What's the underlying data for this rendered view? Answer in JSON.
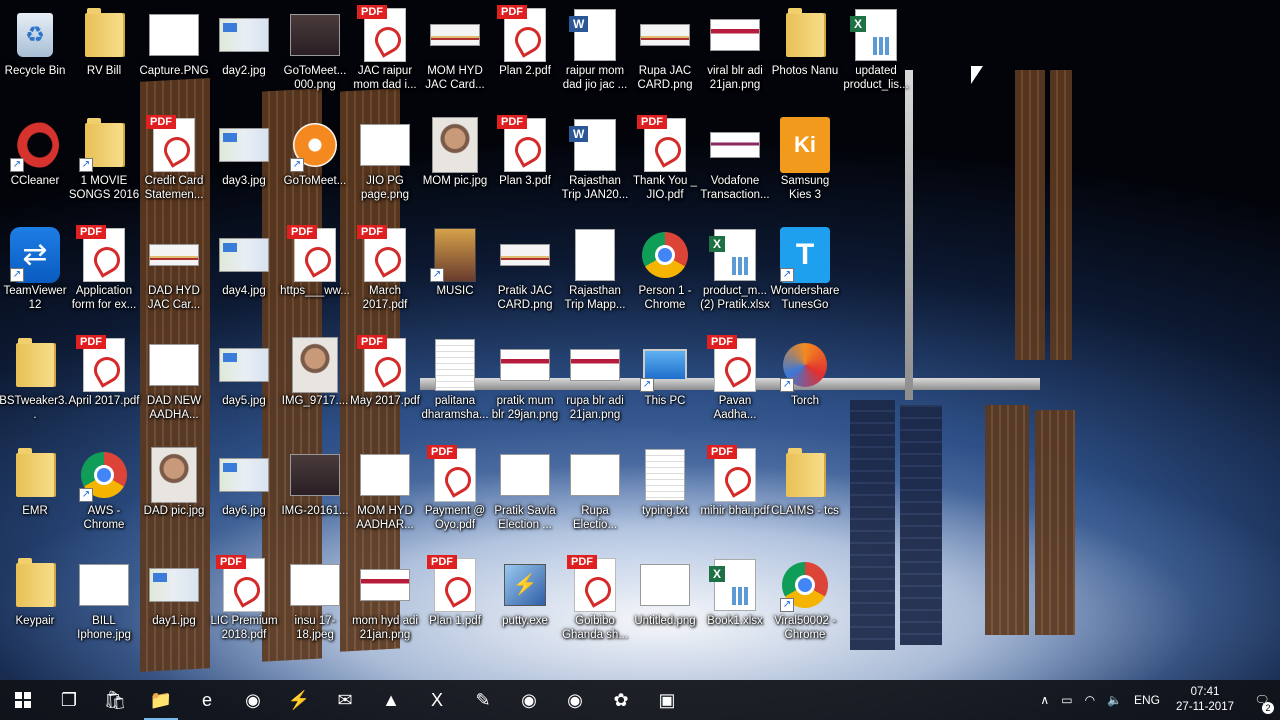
{
  "desktop": {
    "icons": [
      {
        "label": "Recycle Bin",
        "type": "recycle",
        "shortcut": false
      },
      {
        "label": "RV Bill",
        "type": "folder",
        "shortcut": false
      },
      {
        "label": "Capture.PNG",
        "type": "doc",
        "shortcut": false
      },
      {
        "label": "day2.jpg",
        "type": "map",
        "shortcut": false
      },
      {
        "label": "GoToMeet... 000.png",
        "type": "dark",
        "shortcut": false
      },
      {
        "label": "JAC raipur mom dad i...",
        "type": "pdf",
        "shortcut": false
      },
      {
        "label": "MOM HYD JAC Card...",
        "type": "card",
        "shortcut": false
      },
      {
        "label": "Plan 2.pdf",
        "type": "pdf",
        "shortcut": false
      },
      {
        "label": "raipur mom dad jio jac ...",
        "type": "word",
        "shortcut": false
      },
      {
        "label": "Rupa JAC CARD.png",
        "type": "card",
        "shortcut": false
      },
      {
        "label": "viral blr adi 21jan.png",
        "type": "web",
        "shortcut": false
      },
      {
        "label": "Photos Nanu",
        "type": "folder",
        "shortcut": false
      },
      {
        "label": "updated product_lis...",
        "type": "excel",
        "shortcut": false
      },
      {
        "label": "CCleaner",
        "type": "ccleaner",
        "shortcut": true
      },
      {
        "label": "1 MOVIE SONGS 2016",
        "type": "folder",
        "shortcut": true
      },
      {
        "label": "Credit Card Statemen...",
        "type": "pdf",
        "shortcut": false
      },
      {
        "label": "day3.jpg",
        "type": "map",
        "shortcut": false
      },
      {
        "label": "GoToMeet...",
        "type": "gotomeet",
        "shortcut": true
      },
      {
        "label": "JIO PG page.png",
        "type": "doc",
        "shortcut": false
      },
      {
        "label": "MOM pic.jpg",
        "type": "photo",
        "shortcut": false
      },
      {
        "label": "Plan 3.pdf",
        "type": "pdf",
        "shortcut": false
      },
      {
        "label": "Rajasthan Trip JAN20...",
        "type": "word",
        "shortcut": false
      },
      {
        "label": "Thank You _ JIO.pdf",
        "type": "pdf",
        "shortcut": false
      },
      {
        "label": "Vodafone Transaction...",
        "type": "pink",
        "shortcut": false
      },
      {
        "label": "Samsung Kies 3",
        "type": "kies",
        "shortcut": false
      },
      {
        "label": "TeamViewer 12",
        "type": "teamviewer",
        "shortcut": true
      },
      {
        "label": "Application form for ex...",
        "type": "pdf",
        "shortcut": false
      },
      {
        "label": "DAD HYD JAC Car...",
        "type": "card",
        "shortcut": false
      },
      {
        "label": "day4.jpg",
        "type": "map",
        "shortcut": false
      },
      {
        "label": "https___ww...",
        "type": "pdf",
        "shortcut": false
      },
      {
        "label": "March 2017.pdf",
        "type": "pdf",
        "shortcut": false
      },
      {
        "label": "MUSIC",
        "type": "music",
        "shortcut": true
      },
      {
        "label": "Pratik JAC CARD.png",
        "type": "card",
        "shortcut": false
      },
      {
        "label": "Rajasthan Trip Mapp...",
        "type": "gen",
        "shortcut": false
      },
      {
        "label": "Person 1 - Chrome",
        "type": "chrome",
        "shortcut": false
      },
      {
        "label": "product_m... (2) Pratik.xlsx",
        "type": "excel",
        "shortcut": false
      },
      {
        "label": "Wondershare TunesGo",
        "type": "wondershare",
        "shortcut": true
      },
      {
        "label": "BSTweaker3...",
        "type": "folder",
        "shortcut": false
      },
      {
        "label": "April 2017.pdf",
        "type": "pdf",
        "shortcut": false
      },
      {
        "label": "DAD NEW AADHA...",
        "type": "doc",
        "shortcut": false
      },
      {
        "label": "day5.jpg",
        "type": "map",
        "shortcut": false
      },
      {
        "label": "IMG_9717....",
        "type": "photo",
        "shortcut": false
      },
      {
        "label": "May 2017.pdf",
        "type": "pdf",
        "shortcut": false
      },
      {
        "label": "palitana dharamsha...",
        "type": "txt",
        "shortcut": false
      },
      {
        "label": "pratik mum blr 29jan.png",
        "type": "web",
        "shortcut": false
      },
      {
        "label": "rupa blr adi 21jan.png",
        "type": "web",
        "shortcut": false
      },
      {
        "label": "This PC",
        "type": "pc",
        "shortcut": true
      },
      {
        "label": "Pavan Aadha...",
        "type": "pdf",
        "shortcut": false
      },
      {
        "label": "Torch",
        "type": "torch",
        "shortcut": true
      },
      {
        "label": "EMR",
        "type": "folder",
        "shortcut": false
      },
      {
        "label": "AWS - Chrome",
        "type": "chrome",
        "shortcut": true
      },
      {
        "label": "DAD pic.jpg",
        "type": "photo",
        "shortcut": false
      },
      {
        "label": "day6.jpg",
        "type": "map",
        "shortcut": false
      },
      {
        "label": "IMG-20161...",
        "type": "dark",
        "shortcut": false
      },
      {
        "label": "MOM HYD AADHAR...",
        "type": "doc",
        "shortcut": false
      },
      {
        "label": "Payment @ Oyo.pdf",
        "type": "pdf",
        "shortcut": false
      },
      {
        "label": "Pratik Savla Election ...",
        "type": "doc",
        "shortcut": false
      },
      {
        "label": "Rupa Electio...",
        "type": "doc",
        "shortcut": false
      },
      {
        "label": "typing.txt",
        "type": "txt",
        "shortcut": false
      },
      {
        "label": "mihir bhai.pdf",
        "type": "pdf",
        "shortcut": false
      },
      {
        "label": "CLAIMS - tcs",
        "type": "folder",
        "shortcut": false
      },
      {
        "label": "Keypair",
        "type": "folder",
        "shortcut": false
      },
      {
        "label": "BILL Iphone.jpg",
        "type": "doc",
        "shortcut": false
      },
      {
        "label": "day1.jpg",
        "type": "map",
        "shortcut": false
      },
      {
        "label": "LIC Premium 2018.pdf",
        "type": "pdf",
        "shortcut": false
      },
      {
        "label": "insu 17-18.jpeg",
        "type": "doc",
        "shortcut": false
      },
      {
        "label": "mom hyd adi 21jan.png",
        "type": "web",
        "shortcut": false
      },
      {
        "label": "Plan 1.pdf",
        "type": "pdf",
        "shortcut": false
      },
      {
        "label": "putty.exe",
        "type": "putty",
        "shortcut": false
      },
      {
        "label": "Goibibo Ghanda sh...",
        "type": "pdf",
        "shortcut": false
      },
      {
        "label": "Untitled.png",
        "type": "doc",
        "shortcut": false
      },
      {
        "label": "Book1.xlsx",
        "type": "excel",
        "shortcut": false
      },
      {
        "label": "Viral50002 - Chrome",
        "type": "chrome",
        "shortcut": true
      }
    ]
  },
  "taskbar": {
    "start": "start-button",
    "apps": [
      {
        "name": "task-view-icon",
        "glyph": "❐",
        "active": false
      },
      {
        "name": "store-icon",
        "glyph": "🛍",
        "active": false
      },
      {
        "name": "file-explorer-icon",
        "glyph": "📁",
        "active": true
      },
      {
        "name": "edge-icon",
        "glyph": "e",
        "active": false
      },
      {
        "name": "chrome-icon",
        "glyph": "◉",
        "active": false
      },
      {
        "name": "network-tool-icon",
        "glyph": "⚡",
        "active": false
      },
      {
        "name": "mail-icon",
        "glyph": "✉",
        "active": false
      },
      {
        "name": "vlc-icon",
        "glyph": "▲",
        "active": false
      },
      {
        "name": "excel-icon",
        "glyph": "X",
        "active": false
      },
      {
        "name": "notepad-icon",
        "glyph": "✎",
        "active": false
      },
      {
        "name": "chrome-profile-icon",
        "glyph": "◉",
        "active": false
      },
      {
        "name": "chrome-profile2-icon",
        "glyph": "◉",
        "active": false
      },
      {
        "name": "gotomeeting-icon",
        "glyph": "✿",
        "active": false
      },
      {
        "name": "powerpoint-icon",
        "glyph": "▣",
        "active": false
      }
    ],
    "tray": {
      "language": "ENG",
      "time": "07:41",
      "date": "27-11-2017",
      "notifications": "2"
    }
  },
  "colors": {
    "taskbar": "#101218",
    "accent": "#76b9ed",
    "pdf_red": "#e02020"
  }
}
